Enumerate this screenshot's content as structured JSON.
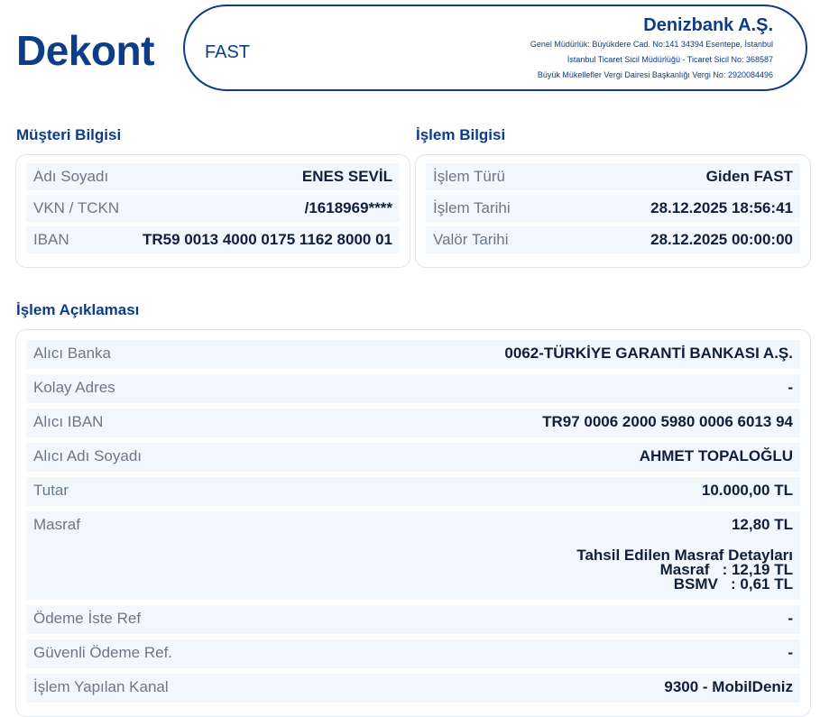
{
  "header": {
    "title": "Dekont",
    "type": "FAST",
    "bank_name": "Denizbank A.Ş.",
    "address": "Genel Müdürlük: Büyükdere Cad. No:141 34394 Esentepe, İstanbul",
    "registry": "İstanbul Ticaret Sicil Müdürlüğü - Ticaret Sicil No: 368587",
    "tax": "Büyük Mükellefler Vergi Dairesi Başkanlığı Vergi No: 2920084496"
  },
  "customer": {
    "section_title": "Müşteri Bilgisi",
    "rows": [
      {
        "label": "Adı Soyadı",
        "value": "ENES SEVİL"
      },
      {
        "label": "VKN / TCKN",
        "value": "/1618969****"
      },
      {
        "label": "IBAN",
        "value": "TR59 0013 4000 0175 1162 8000 01"
      }
    ]
  },
  "transaction": {
    "section_title": "İşlem Bilgisi",
    "rows": [
      {
        "label": "İşlem Türü",
        "value": "Giden FAST"
      },
      {
        "label": "İşlem Tarihi",
        "value": "28.12.2025 18:56:41"
      },
      {
        "label": "Valör Tarihi",
        "value": "28.12.2025 00:00:00"
      }
    ]
  },
  "description": {
    "section_title": "İşlem Açıklaması",
    "rows": [
      {
        "label": "Alıcı Banka",
        "value": "0062-TÜRKİYE GARANTİ BANKASI A.Ş."
      },
      {
        "label": "Kolay Adres",
        "value": "-"
      },
      {
        "label": "Alıcı IBAN",
        "value": "TR97 0006 2000 5980 0006 6013 94"
      },
      {
        "label": "Alıcı Adı Soyadı",
        "value": "AHMET TOPALOĞLU"
      },
      {
        "label": "Tutar",
        "value": "10.000,00 TL"
      },
      {
        "label": "Masraf",
        "value": "12,80 TL"
      },
      {
        "label": "Ödeme İste Ref",
        "value": "-"
      },
      {
        "label": "Güvenli Ödeme Ref.",
        "value": "-"
      },
      {
        "label": "İşlem Yapılan Kanal",
        "value": "9300 - MobilDeniz"
      }
    ],
    "masraf_details": {
      "heading": "Tahsil Edilen Masraf Detayları",
      "line1": "Masraf   : 12,19 TL",
      "line2": "BSMV   : 0,61 TL"
    }
  }
}
